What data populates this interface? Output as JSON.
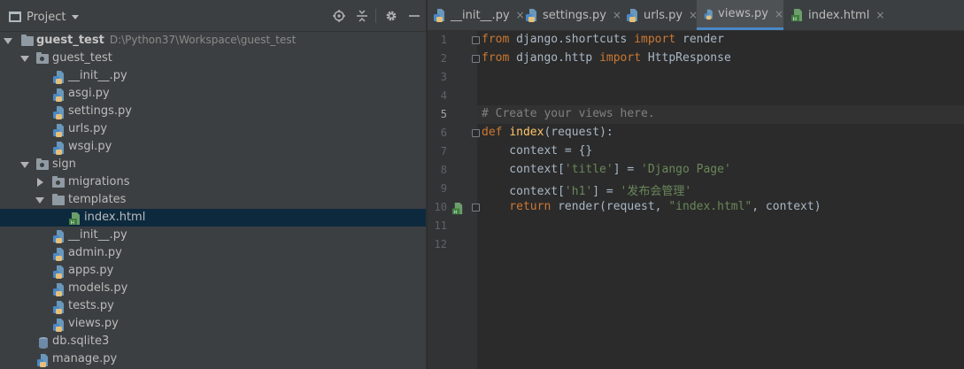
{
  "panel": {
    "title": "Project"
  },
  "tree": [
    {
      "name": "guest_test",
      "path": "D:\\Python37\\Workspace\\guest_test"
    },
    {
      "name": "guest_test"
    },
    {
      "name": "__init__.py"
    },
    {
      "name": "asgi.py"
    },
    {
      "name": "settings.py"
    },
    {
      "name": "urls.py"
    },
    {
      "name": "wsgi.py"
    },
    {
      "name": "sign"
    },
    {
      "name": "migrations"
    },
    {
      "name": "templates"
    },
    {
      "name": "index.html"
    },
    {
      "name": "__init__.py"
    },
    {
      "name": "admin.py"
    },
    {
      "name": "apps.py"
    },
    {
      "name": "models.py"
    },
    {
      "name": "tests.py"
    },
    {
      "name": "views.py"
    },
    {
      "name": "db.sqlite3"
    },
    {
      "name": "manage.py"
    }
  ],
  "tabs": [
    {
      "label": "__init__.py"
    },
    {
      "label": "settings.py"
    },
    {
      "label": "urls.py"
    },
    {
      "label": "views.py"
    },
    {
      "label": "index.html"
    }
  ],
  "tab_close": "×",
  "editor": {
    "line_numbers": [
      "1",
      "2",
      "3",
      "4",
      "5",
      "6",
      "7",
      "8",
      "9",
      "10",
      "11",
      "12"
    ],
    "code": {
      "l1_from": "from",
      "l1_mod": " django.shortcuts ",
      "l1_import": "import",
      "l1_name": " render",
      "l2_from": "from",
      "l2_mod": " django.http ",
      "l2_import": "import",
      "l2_name": " HttpResponse",
      "l5_comment": "# Create your views here.",
      "l6_def": "def",
      "l6_fn": "index",
      "l6_args": "(request):",
      "l7": "    context = {}",
      "l8_a": "    context[",
      "l8_key": "'title'",
      "l8_b": "] = ",
      "l8_val": "'Django Page'",
      "l9_a": "    context[",
      "l9_key": "'h1'",
      "l9_b": "] = ",
      "l9_val": "'发布会管理'",
      "l10_return": "    return",
      "l10_a": " render(request, ",
      "l10_str": "\"index.html\"",
      "l10_b": ", context)"
    }
  },
  "colors": {
    "keyword": "#cc7832",
    "function": "#ffc66d",
    "string": "#6a8759",
    "comment": "#808080",
    "selection": "#0d293e",
    "tab_underline": "#4a88c7"
  }
}
